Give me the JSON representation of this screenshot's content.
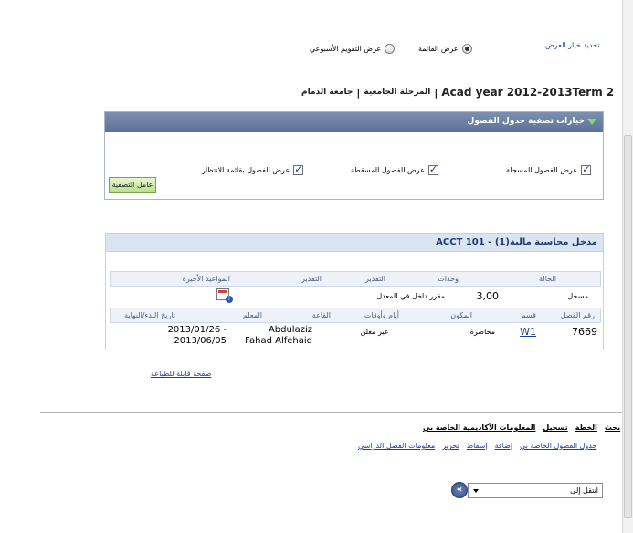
{
  "display": {
    "change_label": "تحديد خيار العرض",
    "option_list": "عرض القائمة",
    "option_weekly": "عرض التقويم الأسبوعي",
    "selected": "list"
  },
  "term": {
    "title": "Acad year 2012-2013Term 2",
    "career": "المرحلة الجامعية",
    "institution": "جامعة الدمام"
  },
  "filter": {
    "title": "خيارات تصفية جدول الفصول",
    "show_enrolled": "عرض الفصول المسجلة",
    "show_dropped": "عرض الفصول المسقطة",
    "show_waitlisted": "عرض الفصول بقائمة الانتظار",
    "apply_label": "عامل التصفية"
  },
  "course": {
    "title": "ACCT 101 - مدخل محاسبة مالية(1)",
    "summary_headers": {
      "status": "الحالة",
      "units": "وحدات",
      "grading": "التقدير",
      "grade": "التقدير",
      "deadlines": "المواعيد الأخيرة"
    },
    "summary_row": {
      "status": "مسجل",
      "units": "3,00",
      "grading": "مقرر داخل في المعدل",
      "grade": ""
    },
    "detail_headers": {
      "class_nbr": "رقم الفصل",
      "section": "قسم",
      "component": "المكون",
      "days_times": "أيام وأوقات",
      "room": "القاعة",
      "instructor": "المعلم",
      "dates": "تاريخ البدء/النهاية"
    },
    "detail_row": {
      "class_nbr": "7669",
      "section": "W1",
      "component": "محاضرة",
      "days_times": "غير معلن",
      "room": "",
      "instructor_line1": "Abdulaziz",
      "instructor_line2": "Fahad Alfehaid",
      "dates_line1": "2013/01/26 -",
      "dates_line2": "2013/06/05"
    }
  },
  "printer_link": "صفحة قابلة للطباعة",
  "nav": {
    "primary": [
      "بحث",
      "الخطة",
      "تسجيل",
      "المعلومات الأكاديمية الخاصة بي"
    ],
    "secondary": [
      "جدول الفصول الخاصة بي",
      "إضافة",
      "إسقاط",
      "تحرير",
      "معلومات الفصل الدراسي"
    ]
  },
  "goto": {
    "select_value": "انتقل إلى",
    "go_symbol": "«"
  },
  "colors": {
    "header_bg": "#6a7ea6",
    "accent_link": "#1a3fa3",
    "class_header_bg": "#dbe4f1",
    "apply_button": "#c6e79e"
  }
}
